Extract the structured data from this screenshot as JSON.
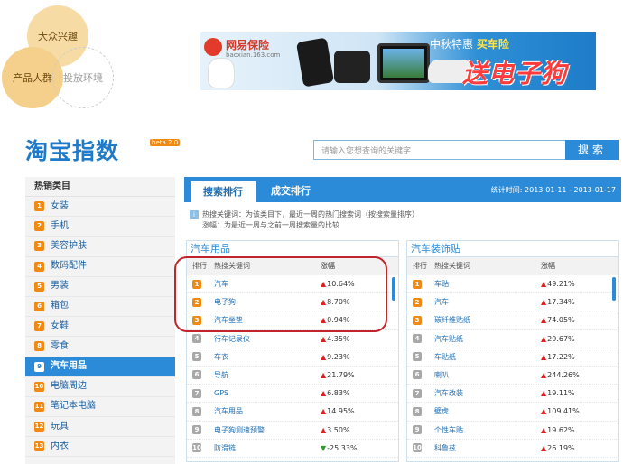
{
  "venn": {
    "interest": "大众兴趣",
    "crowd": "产品人群",
    "env": "投放环境"
  },
  "banner": {
    "brand": "网易保险",
    "url": "baoxian.163.com",
    "promo_prefix": "中秋特惠",
    "promo_highlight": "买车险",
    "big_text": "送电子狗"
  },
  "header": {
    "logo": "淘宝指数",
    "beta": "beta 2.0",
    "search_placeholder": "请输入您想查询的关键字",
    "search_button": "搜索"
  },
  "sidebar": {
    "title": "热销类目",
    "items": [
      {
        "num": "1",
        "label": "女装"
      },
      {
        "num": "2",
        "label": "手机"
      },
      {
        "num": "3",
        "label": "美容护肤"
      },
      {
        "num": "4",
        "label": "数码配件"
      },
      {
        "num": "5",
        "label": "男装"
      },
      {
        "num": "6",
        "label": "箱包"
      },
      {
        "num": "7",
        "label": "女鞋"
      },
      {
        "num": "8",
        "label": "零食"
      },
      {
        "num": "9",
        "label": "汽车用品"
      },
      {
        "num": "10",
        "label": "电脑周边"
      },
      {
        "num": "11",
        "label": "笔记本电脑"
      },
      {
        "num": "12",
        "label": "玩具"
      },
      {
        "num": "13",
        "label": "内衣"
      }
    ]
  },
  "tabs": {
    "search_rank": "搜索排行",
    "deal_rank": "成交排行",
    "stat_time": "统计时间: 2013-01-11 - 2013-01-17"
  },
  "notes": {
    "icon": "i",
    "line1": "热搜关键词：为该类目下，最近一周的热门搜索词（按搜索量排序）",
    "line2": "涨幅：为最近一周与之前一周搜索量的比较"
  },
  "columns": {
    "rank": "排行",
    "keyword": "热搜关键词",
    "change": "涨幅"
  },
  "left_panel": {
    "title": "汽车用品",
    "rows": [
      {
        "rank": "1",
        "kw": "汽车",
        "dir": "up",
        "chg": "10.64%"
      },
      {
        "rank": "2",
        "kw": "电子狗",
        "dir": "up",
        "chg": "8.70%"
      },
      {
        "rank": "3",
        "kw": "汽车坐垫",
        "dir": "up",
        "chg": "0.94%"
      },
      {
        "rank": "4",
        "kw": "行车记录仪",
        "dir": "up",
        "chg": "4.35%"
      },
      {
        "rank": "5",
        "kw": "车衣",
        "dir": "up",
        "chg": "9.23%"
      },
      {
        "rank": "6",
        "kw": "导航",
        "dir": "up",
        "chg": "21.79%"
      },
      {
        "rank": "7",
        "kw": "GPS",
        "dir": "up",
        "chg": "6.83%"
      },
      {
        "rank": "8",
        "kw": "汽车用品",
        "dir": "up",
        "chg": "14.95%"
      },
      {
        "rank": "9",
        "kw": "电子狗测速预警",
        "dir": "up",
        "chg": "3.50%"
      },
      {
        "rank": "10",
        "kw": "防滑链",
        "dir": "down",
        "chg": "-25.33%"
      }
    ]
  },
  "right_panel": {
    "title": "汽车装饰贴",
    "rows": [
      {
        "rank": "1",
        "kw": "车贴",
        "dir": "up",
        "chg": "49.21%"
      },
      {
        "rank": "2",
        "kw": "汽车",
        "dir": "up",
        "chg": "17.34%"
      },
      {
        "rank": "3",
        "kw": "碳纤维贴纸",
        "dir": "up",
        "chg": "74.05%"
      },
      {
        "rank": "4",
        "kw": "汽车贴纸",
        "dir": "up",
        "chg": "29.67%"
      },
      {
        "rank": "5",
        "kw": "车贴纸",
        "dir": "up",
        "chg": "17.22%"
      },
      {
        "rank": "6",
        "kw": "喇叭",
        "dir": "up",
        "chg": "244.26%"
      },
      {
        "rank": "7",
        "kw": "汽车改装",
        "dir": "up",
        "chg": "19.11%"
      },
      {
        "rank": "8",
        "kw": "壁虎",
        "dir": "up",
        "chg": "109.41%"
      },
      {
        "rank": "9",
        "kw": "个性车贴",
        "dir": "up",
        "chg": "19.62%"
      },
      {
        "rank": "10",
        "kw": "科鲁兹",
        "dir": "up",
        "chg": "26.19%"
      }
    ]
  }
}
